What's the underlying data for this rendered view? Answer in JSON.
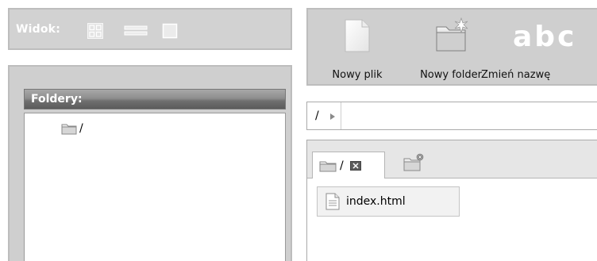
{
  "view": {
    "label": "Widok:",
    "icons": [
      "thumbnails-view-icon",
      "list-view-icon",
      "single-view-icon"
    ]
  },
  "folders": {
    "title": "Foldery:",
    "tree": [
      {
        "label": "/",
        "icon": "folder-icon"
      }
    ]
  },
  "toolbar": {
    "new_file": {
      "label": "Nowy plik",
      "icon": "new-file-icon"
    },
    "new_folder": {
      "label": "Nowy folder",
      "icon": "new-folder-icon"
    },
    "rename": {
      "label": "Zmień nazwę",
      "icon_text": "abc",
      "icon": "rename-icon"
    }
  },
  "pathbar": {
    "path": "/"
  },
  "tabs": [
    {
      "label": "/",
      "icon": "folder-icon",
      "close_icon": "close-icon"
    }
  ],
  "new_tab_icon": "new-tab-folder-icon",
  "files": [
    {
      "name": "index.html",
      "icon": "document-icon"
    }
  ]
}
